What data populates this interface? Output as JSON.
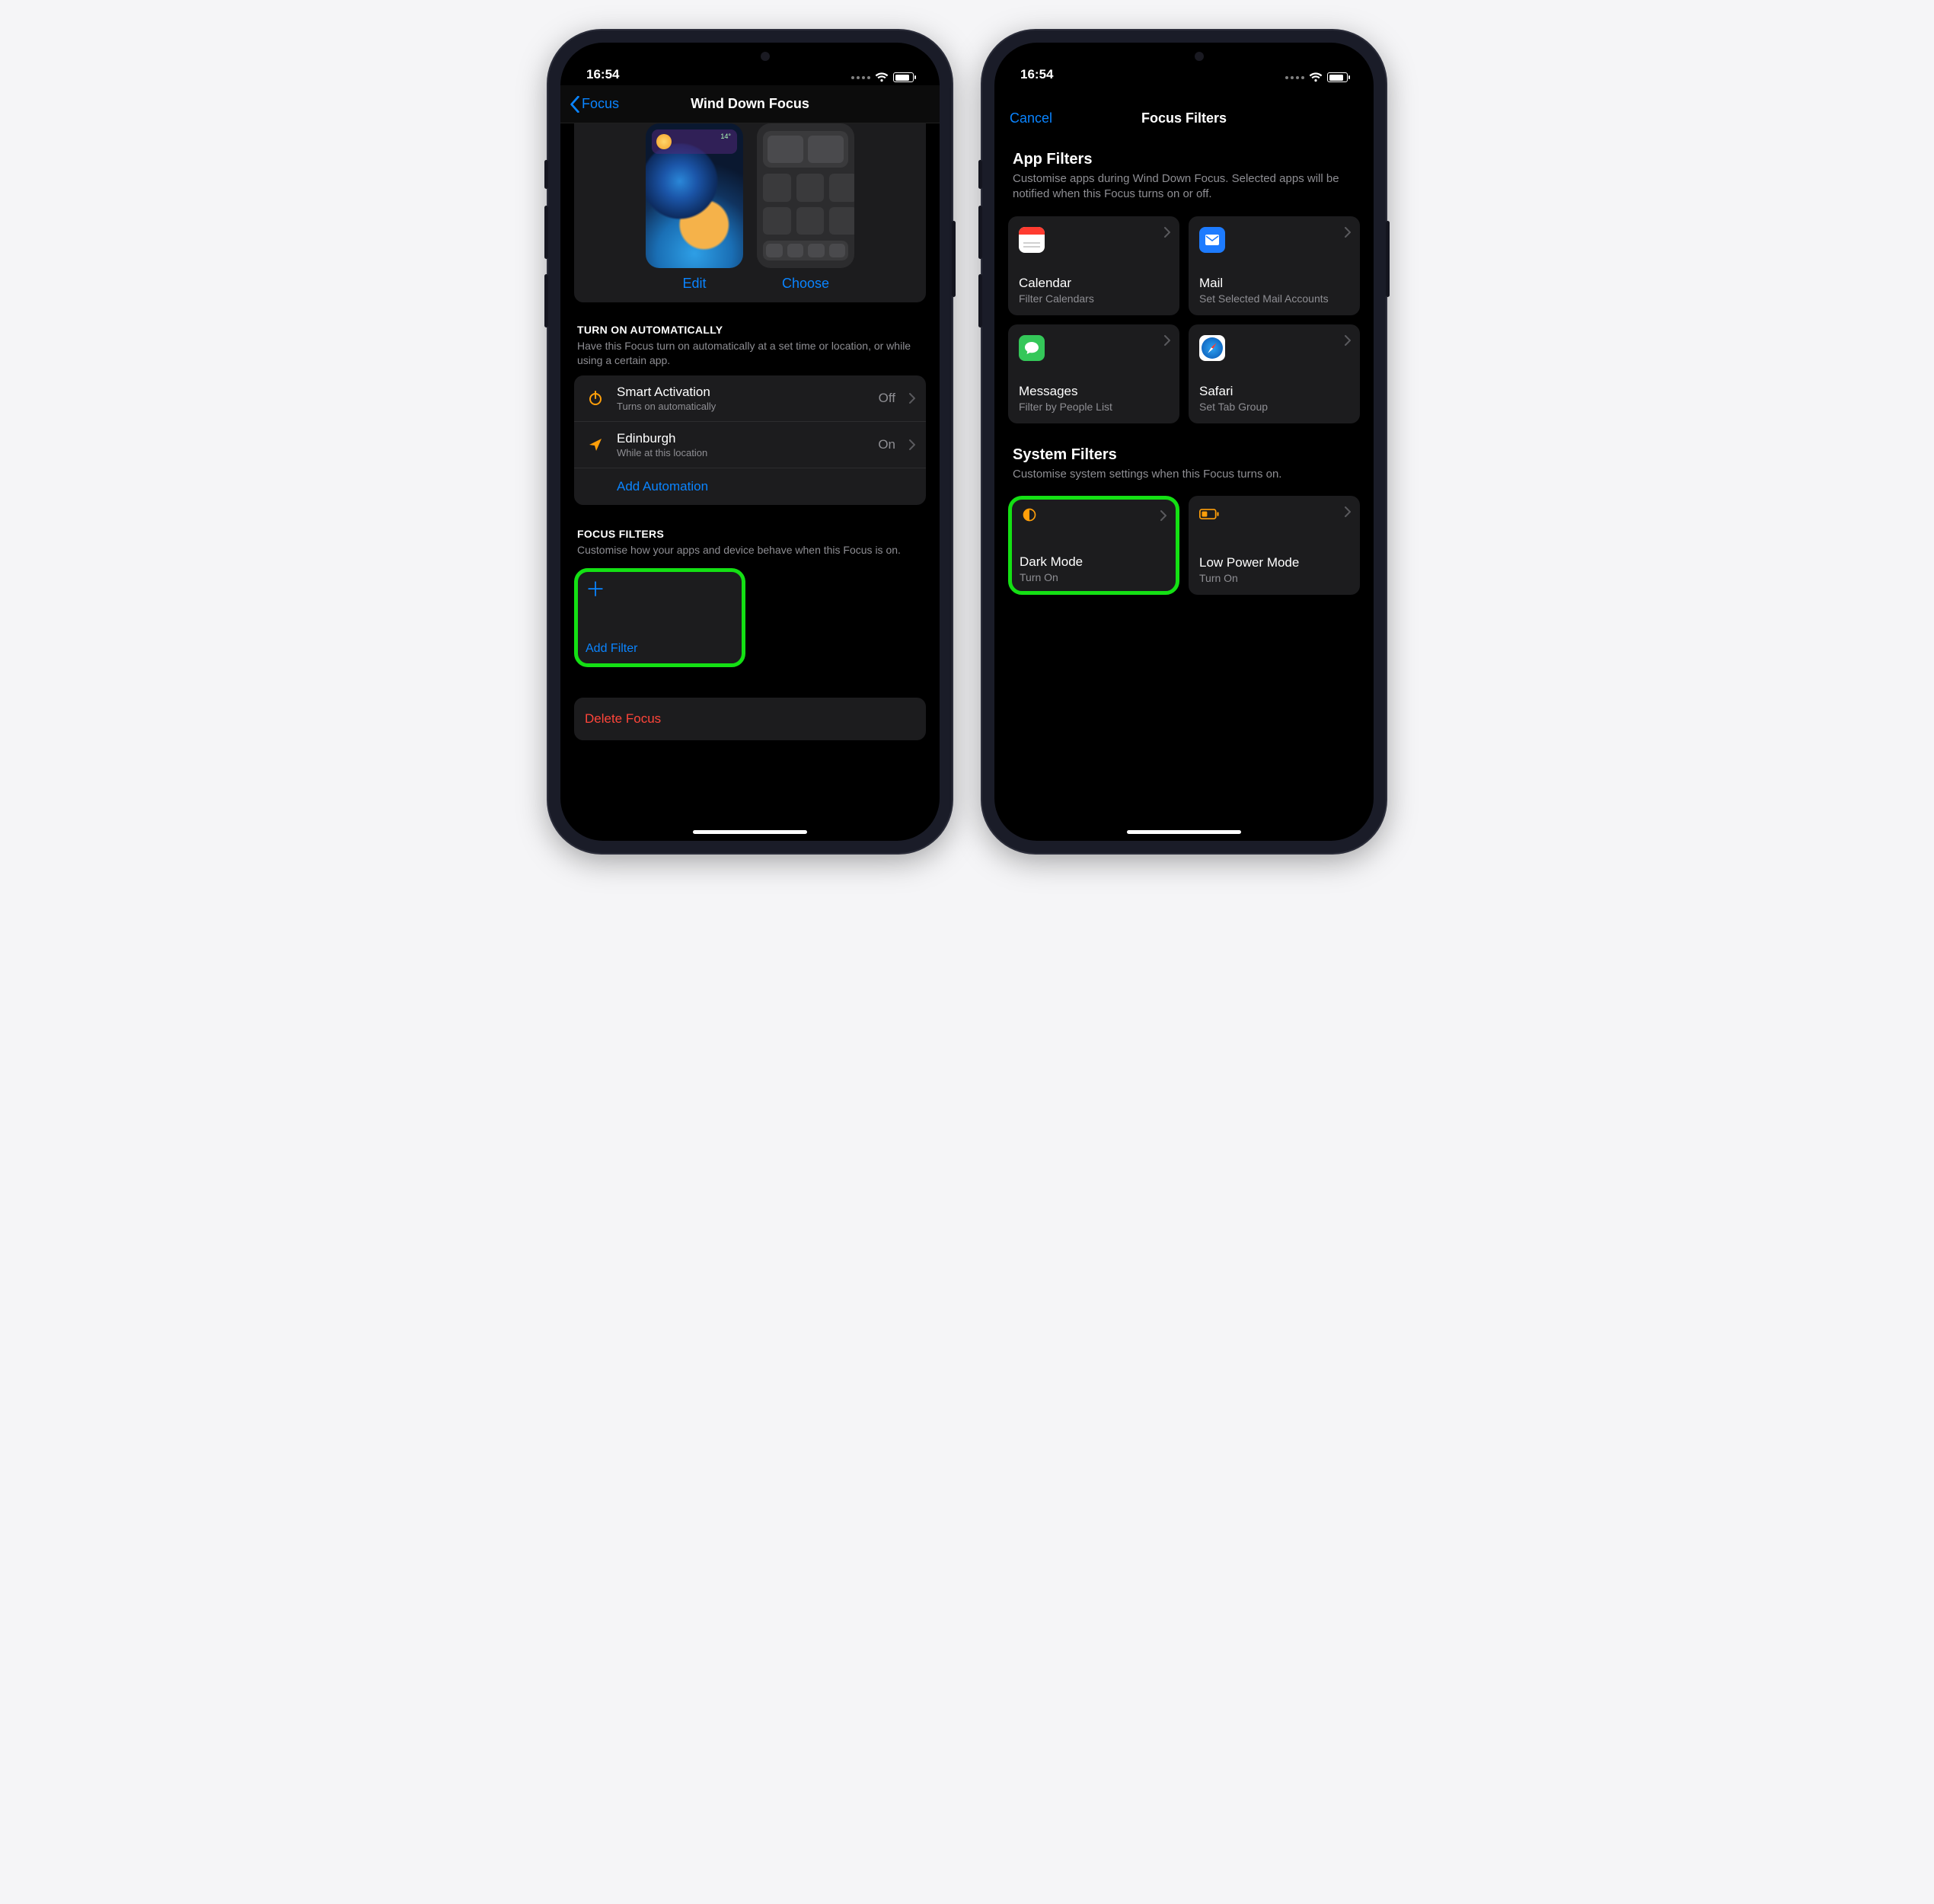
{
  "status": {
    "time": "16:54"
  },
  "left": {
    "back_label": "Focus",
    "title": "Wind Down Focus",
    "screens": {
      "edit": "Edit",
      "choose": "Choose",
      "widget_temp": "14°"
    },
    "auto": {
      "heading": "TURN ON AUTOMATICALLY",
      "desc": "Have this Focus turn on automatically at a set time or location, or while using a certain app.",
      "rows": [
        {
          "title": "Smart Activation",
          "sub": "Turns on automatically",
          "value": "Off"
        },
        {
          "title": "Edinburgh",
          "sub": "While at this location",
          "value": "On"
        }
      ],
      "add": "Add Automation"
    },
    "filters": {
      "heading": "FOCUS FILTERS",
      "desc": "Customise how your apps and device behave when this Focus is on.",
      "add": "Add Filter"
    },
    "delete": "Delete Focus"
  },
  "right": {
    "cancel": "Cancel",
    "title": "Focus Filters",
    "app": {
      "heading": "App Filters",
      "desc": "Customise apps during Wind Down Focus. Selected apps will be notified when this Focus turns on or off.",
      "tiles": [
        {
          "title": "Calendar",
          "sub": "Filter Calendars"
        },
        {
          "title": "Mail",
          "sub": "Set Selected Mail Accounts"
        },
        {
          "title": "Messages",
          "sub": "Filter by People List"
        },
        {
          "title": "Safari",
          "sub": "Set Tab Group"
        }
      ]
    },
    "sys": {
      "heading": "System Filters",
      "desc": "Customise system settings when this Focus turns on.",
      "tiles": [
        {
          "title": "Dark Mode",
          "sub": "Turn On"
        },
        {
          "title": "Low Power Mode",
          "sub": "Turn On"
        }
      ]
    }
  }
}
